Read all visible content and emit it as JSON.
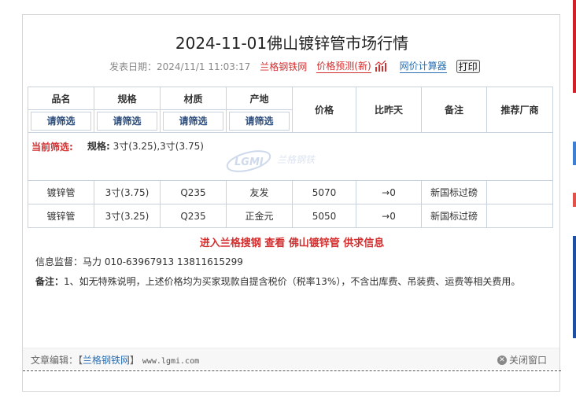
{
  "title": "2024-11-01佛山镀锌管市场行情",
  "meta": {
    "publish_label": "发表日期：",
    "publish_date": "2024/11/1 11:03:17",
    "source": "兰格钢铁网",
    "forecast": "价格预测(新)",
    "calculator": "网价计算器",
    "print": "打印"
  },
  "table": {
    "headers": {
      "name": "品名",
      "spec": "规格",
      "material": "材质",
      "origin": "产地",
      "price": "价格",
      "change": "比昨天",
      "remark": "备注",
      "vendor": "推荐厂商"
    },
    "filter_button": "请筛选",
    "current_filter_label": "当前筛选:",
    "current_filter_key": "规格:",
    "current_filter_value": "3寸(3.25),3寸(3.75)",
    "rows": [
      {
        "name": "镀锌管",
        "spec": "3寸(3.75)",
        "material": "Q235",
        "origin": "友发",
        "price": "5070",
        "change": "→0",
        "remark": "新国标过磅",
        "vendor": ""
      },
      {
        "name": "镀锌管",
        "spec": "3寸(3.25)",
        "material": "Q235",
        "origin": "正金元",
        "price": "5050",
        "change": "→0",
        "remark": "新国标过磅",
        "vendor": ""
      }
    ]
  },
  "promo": "进入兰格搜钢   查看  佛山镀锌管  供求信息",
  "contact": "信息监督：马力 010-63967913 13811615299",
  "note_label": "备注：",
  "note_text": "1、如无特殊说明，上述价格均为买家现款自提含税价（税率13%），不含出库费、吊装费、运费等相关费用。",
  "footer": {
    "editor_label": "文章编辑：【",
    "editor_link": "兰格钢铁网",
    "editor_close": "】",
    "url": "www.lgmi.com",
    "close": "关闭窗口"
  },
  "watermark_text": "兰格钢铁",
  "colors": {
    "accent_red": "#d32f2f",
    "link_blue": "#2a6fb4",
    "header_blue": "#2a4a7a"
  }
}
